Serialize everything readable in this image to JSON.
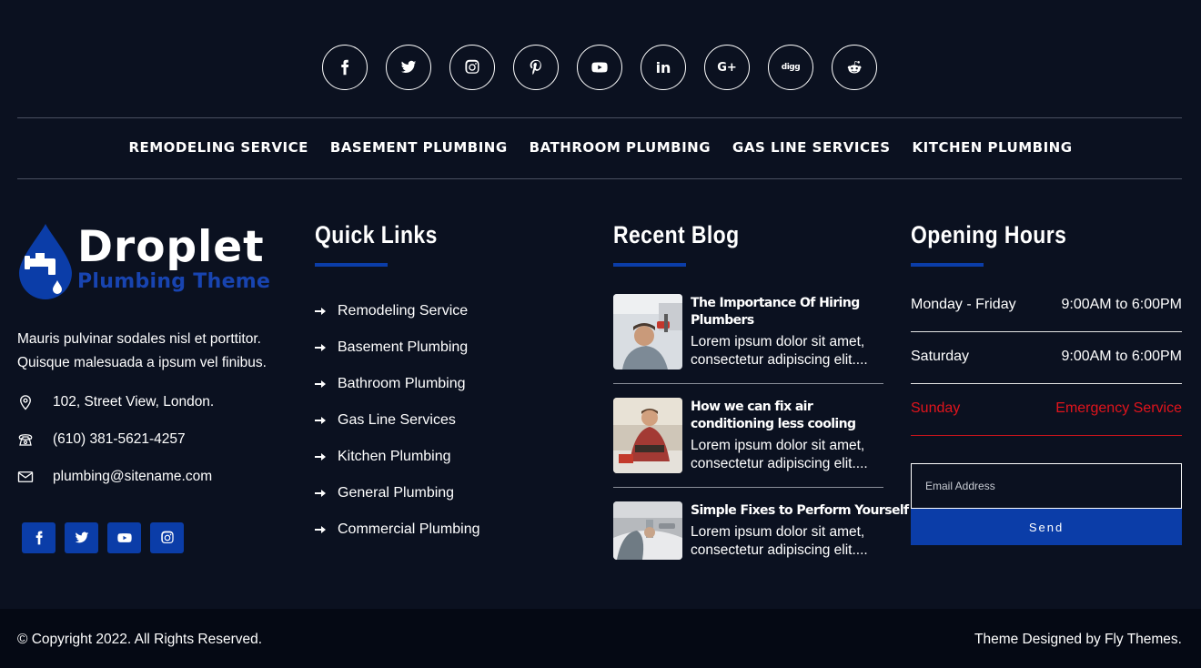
{
  "social_top": [
    {
      "icon": "facebook-icon"
    },
    {
      "icon": "twitter-icon"
    },
    {
      "icon": "instagram-icon"
    },
    {
      "icon": "pinterest-icon"
    },
    {
      "icon": "youtube-icon"
    },
    {
      "icon": "linkedin-icon",
      "glyph": "in"
    },
    {
      "icon": "google-plus-icon",
      "glyph": "G+"
    },
    {
      "icon": "digg-icon",
      "glyph": "digg"
    },
    {
      "icon": "reddit-icon"
    }
  ],
  "service_nav": [
    "REMODELING SERVICE",
    "BASEMENT PLUMBING",
    "BATHROOM PLUMBING",
    "GAS LINE SERVICES",
    "KITCHEN PLUMBING"
  ],
  "brand": {
    "title": "Droplet",
    "subtitle": "Plumbing Theme",
    "about": "Mauris pulvinar sodales nisl et porttitor. Quisque malesuada a ipsum vel finibus.",
    "address": "102, Street View, London.",
    "phone": "(610) 381-5621-4257",
    "email": "plumbing@sitename.com",
    "accent": "#0b3da8"
  },
  "quick_links": {
    "heading": "Quick Links",
    "items": [
      "Remodeling Service",
      "Basement Plumbing",
      "Bathroom Plumbing",
      "Gas Line Services",
      "Kitchen Plumbing",
      "General Plumbing",
      "Commercial Plumbing"
    ]
  },
  "recent_blog": {
    "heading": "Recent Blog",
    "posts": [
      {
        "title": "The Importance Of Hiring Plumbers",
        "excerpt_line1": "Lorem ipsum dolor sit amet,",
        "excerpt_line2": "consectetur adipiscing elit...."
      },
      {
        "title": "How we can fix air conditioning less cooling",
        "excerpt_line1": "Lorem ipsum dolor sit amet,",
        "excerpt_line2": "consectetur adipiscing elit...."
      },
      {
        "title": "Simple Fixes to Perform Yourself",
        "excerpt_line1": "Lorem ipsum dolor sit amet,",
        "excerpt_line2": "consectetur adipiscing elit...."
      }
    ]
  },
  "opening_hours": {
    "heading": "Opening Hours",
    "rows": [
      {
        "day": "Monday - Friday",
        "hours": "9:00AM to 6:00PM"
      },
      {
        "day": "Saturday",
        "hours": "9:00AM to 6:00PM"
      },
      {
        "day": "Sunday",
        "hours": "Emergency Service"
      }
    ],
    "emergency_color": "#e1141c"
  },
  "newsletter": {
    "placeholder": "Email Address",
    "button": "Send"
  },
  "footer": {
    "copyright": "© Copyright 2022. All Rights Reserved.",
    "credit": "Theme Designed by Fly Themes."
  }
}
